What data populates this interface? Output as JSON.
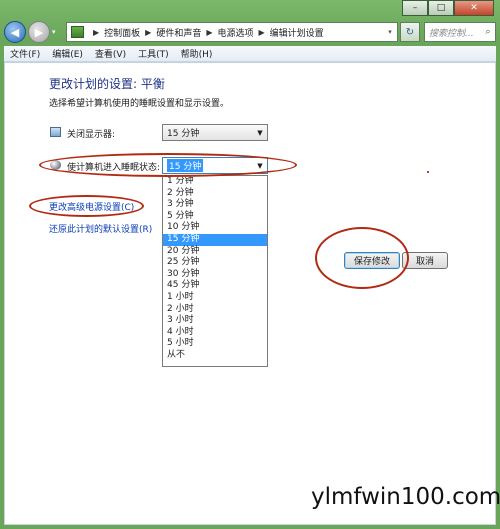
{
  "window": {
    "minimize_glyph": "–",
    "maximize_glyph": "□",
    "close_glyph": "✕"
  },
  "nav": {
    "back_glyph": "◀",
    "forward_glyph": "▶",
    "dropdown_glyph": "▾",
    "refresh_glyph": "↻"
  },
  "breadcrumb": [
    "控制面板",
    "硬件和声音",
    "电源选项",
    "编辑计划设置"
  ],
  "breadcrumb_sep": "▶",
  "search": {
    "placeholder": "搜索控制...",
    "icon": "search-icon"
  },
  "menu": [
    "文件(F)",
    "编辑(E)",
    "查看(V)",
    "工具(T)",
    "帮助(H)"
  ],
  "page": {
    "title": "更改计划的设置: 平衡",
    "subtitle": "选择希望计算机使用的睡眠设置和显示设置。"
  },
  "display_off": {
    "label": "关闭显示器:",
    "value": "15 分钟",
    "icon": "monitor-icon"
  },
  "sleep": {
    "label": "使计算机进入睡眠状态:",
    "value": "15 分钟",
    "icon": "moon-icon"
  },
  "sleep_options": [
    "1 分钟",
    "2 分钟",
    "3 分钟",
    "5 分钟",
    "10 分钟",
    "15 分钟",
    "20 分钟",
    "25 分钟",
    "30 分钟",
    "45 分钟",
    "1 小时",
    "2 小时",
    "3 小时",
    "4 小时",
    "5 小时",
    "从不"
  ],
  "sleep_selected_index": 5,
  "links": {
    "advanced": "更改高级电源设置(C)",
    "restore": "还原此计划的默认设置(R)"
  },
  "buttons": {
    "save": "保存修改",
    "cancel": "取消"
  },
  "annotation_color": "#b22a12",
  "watermark": "ylmfwin100.com"
}
